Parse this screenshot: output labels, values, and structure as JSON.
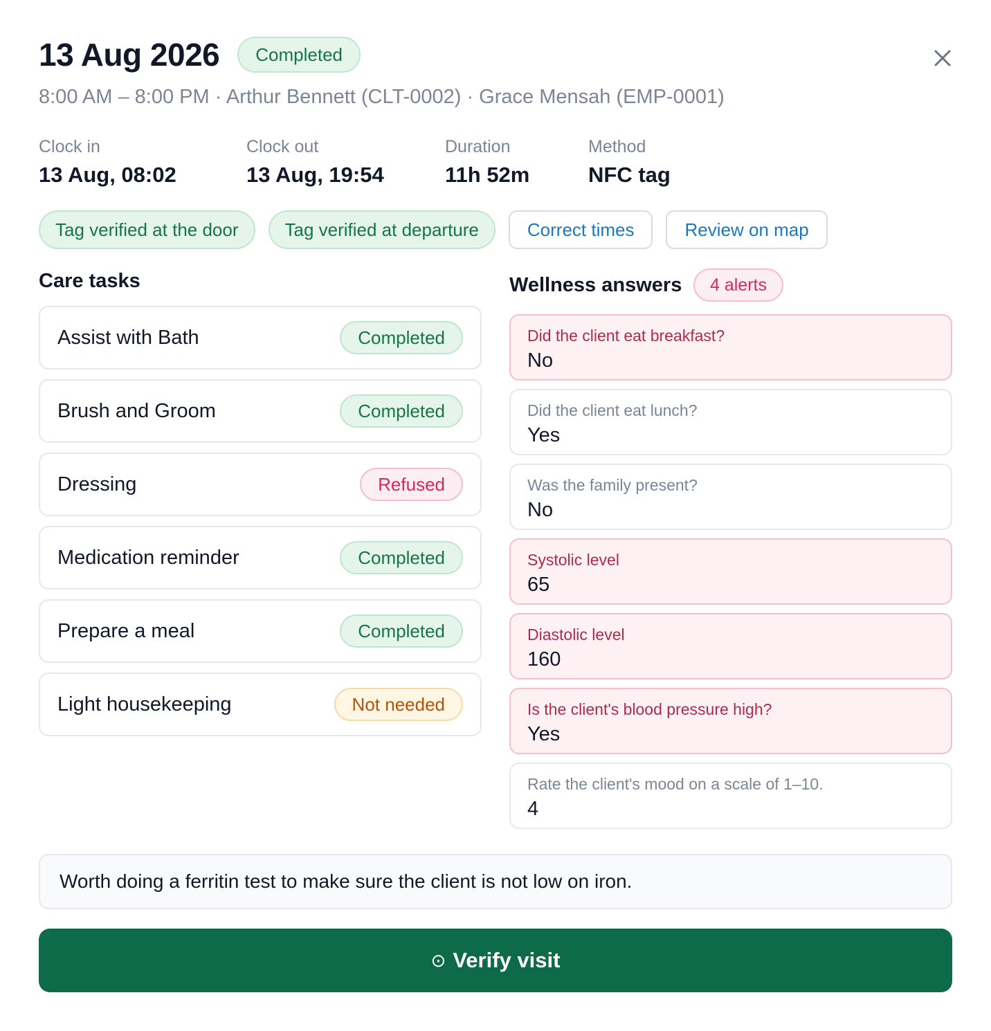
{
  "visit": {
    "date": "13 Aug 2026",
    "status": "Completed",
    "subtitle": "8:00 AM – 8:00 PM · Arthur Bennett (CLT-0002) · Grace Mensah (EMP-0001)"
  },
  "stats": [
    {
      "label": "Clock in",
      "value": "13 Aug, 08:02"
    },
    {
      "label": "Clock out",
      "value": "13 Aug, 19:54"
    },
    {
      "label": "Duration",
      "value": "11h 52m"
    },
    {
      "label": "Method",
      "value": "NFC tag"
    }
  ],
  "verification_chips": [
    "Tag verified at the door",
    "Tag verified at departure"
  ],
  "actions": {
    "correct_times": "Correct times",
    "review_on_map": "Review on map"
  },
  "care_tasks": {
    "title": "Care tasks",
    "items": [
      {
        "name": "Assist with Bath",
        "status": "Completed"
      },
      {
        "name": "Brush and Groom",
        "status": "Completed"
      },
      {
        "name": "Dressing",
        "status": "Refused"
      },
      {
        "name": "Medication reminder",
        "status": "Completed"
      },
      {
        "name": "Prepare a meal",
        "status": "Completed"
      },
      {
        "name": "Light housekeeping",
        "status": "Not needed"
      }
    ]
  },
  "wellness": {
    "title": "Wellness answers",
    "alerts_label": "4 alerts",
    "items": [
      {
        "question": "Did the client eat breakfast?",
        "answer": "No"
      },
      {
        "question": "Did the client eat lunch?",
        "answer": "Yes"
      },
      {
        "question": "Was the family present?",
        "answer": "No"
      },
      {
        "question": "Systolic level",
        "answer": "65"
      },
      {
        "question": "Diastolic level",
        "answer": "160"
      },
      {
        "question": "Is the client's blood pressure high?",
        "answer": "Yes"
      },
      {
        "question": "Rate the client's mood on a scale of 1–10.",
        "answer": "4"
      }
    ]
  },
  "note": "Worth doing a ferritin test to make sure the client is not low on iron.",
  "verify_button": {
    "icon": "⊙",
    "label": "Verify visit"
  },
  "colors": {
    "primary": "#0e6b4a",
    "link": "#1a78c2",
    "alert_bg": "#fdf1f3",
    "success": "#167544"
  }
}
